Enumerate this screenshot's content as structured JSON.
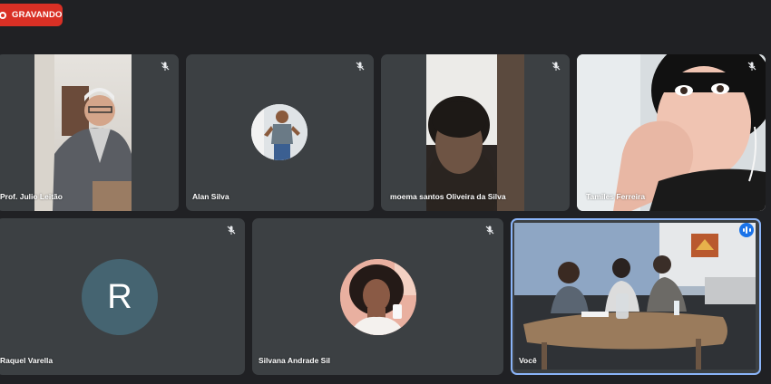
{
  "recording": {
    "label": "GRAVANDO"
  },
  "participants": [
    {
      "name": "Prof. Julio Leitão",
      "muted": true
    },
    {
      "name": "Alan Silva",
      "muted": true
    },
    {
      "name": "moema santos Oliveira da Silva",
      "muted": true
    },
    {
      "name": "Tamiles Ferreira",
      "muted": true
    },
    {
      "name": "Raquel Varella",
      "muted": true,
      "initial": "R"
    },
    {
      "name": "Silvana Andrade Sil",
      "muted": true
    },
    {
      "name": "Você",
      "speaking": true
    }
  ],
  "colors": {
    "background": "#202124",
    "tile": "#3c4043",
    "recording": "#d93025",
    "avatar_initial_bg": "#456471",
    "active_speaker": "#1a73e8"
  },
  "icons": [
    "record-dot-icon",
    "mic-off-icon",
    "audio-level-icon"
  ]
}
